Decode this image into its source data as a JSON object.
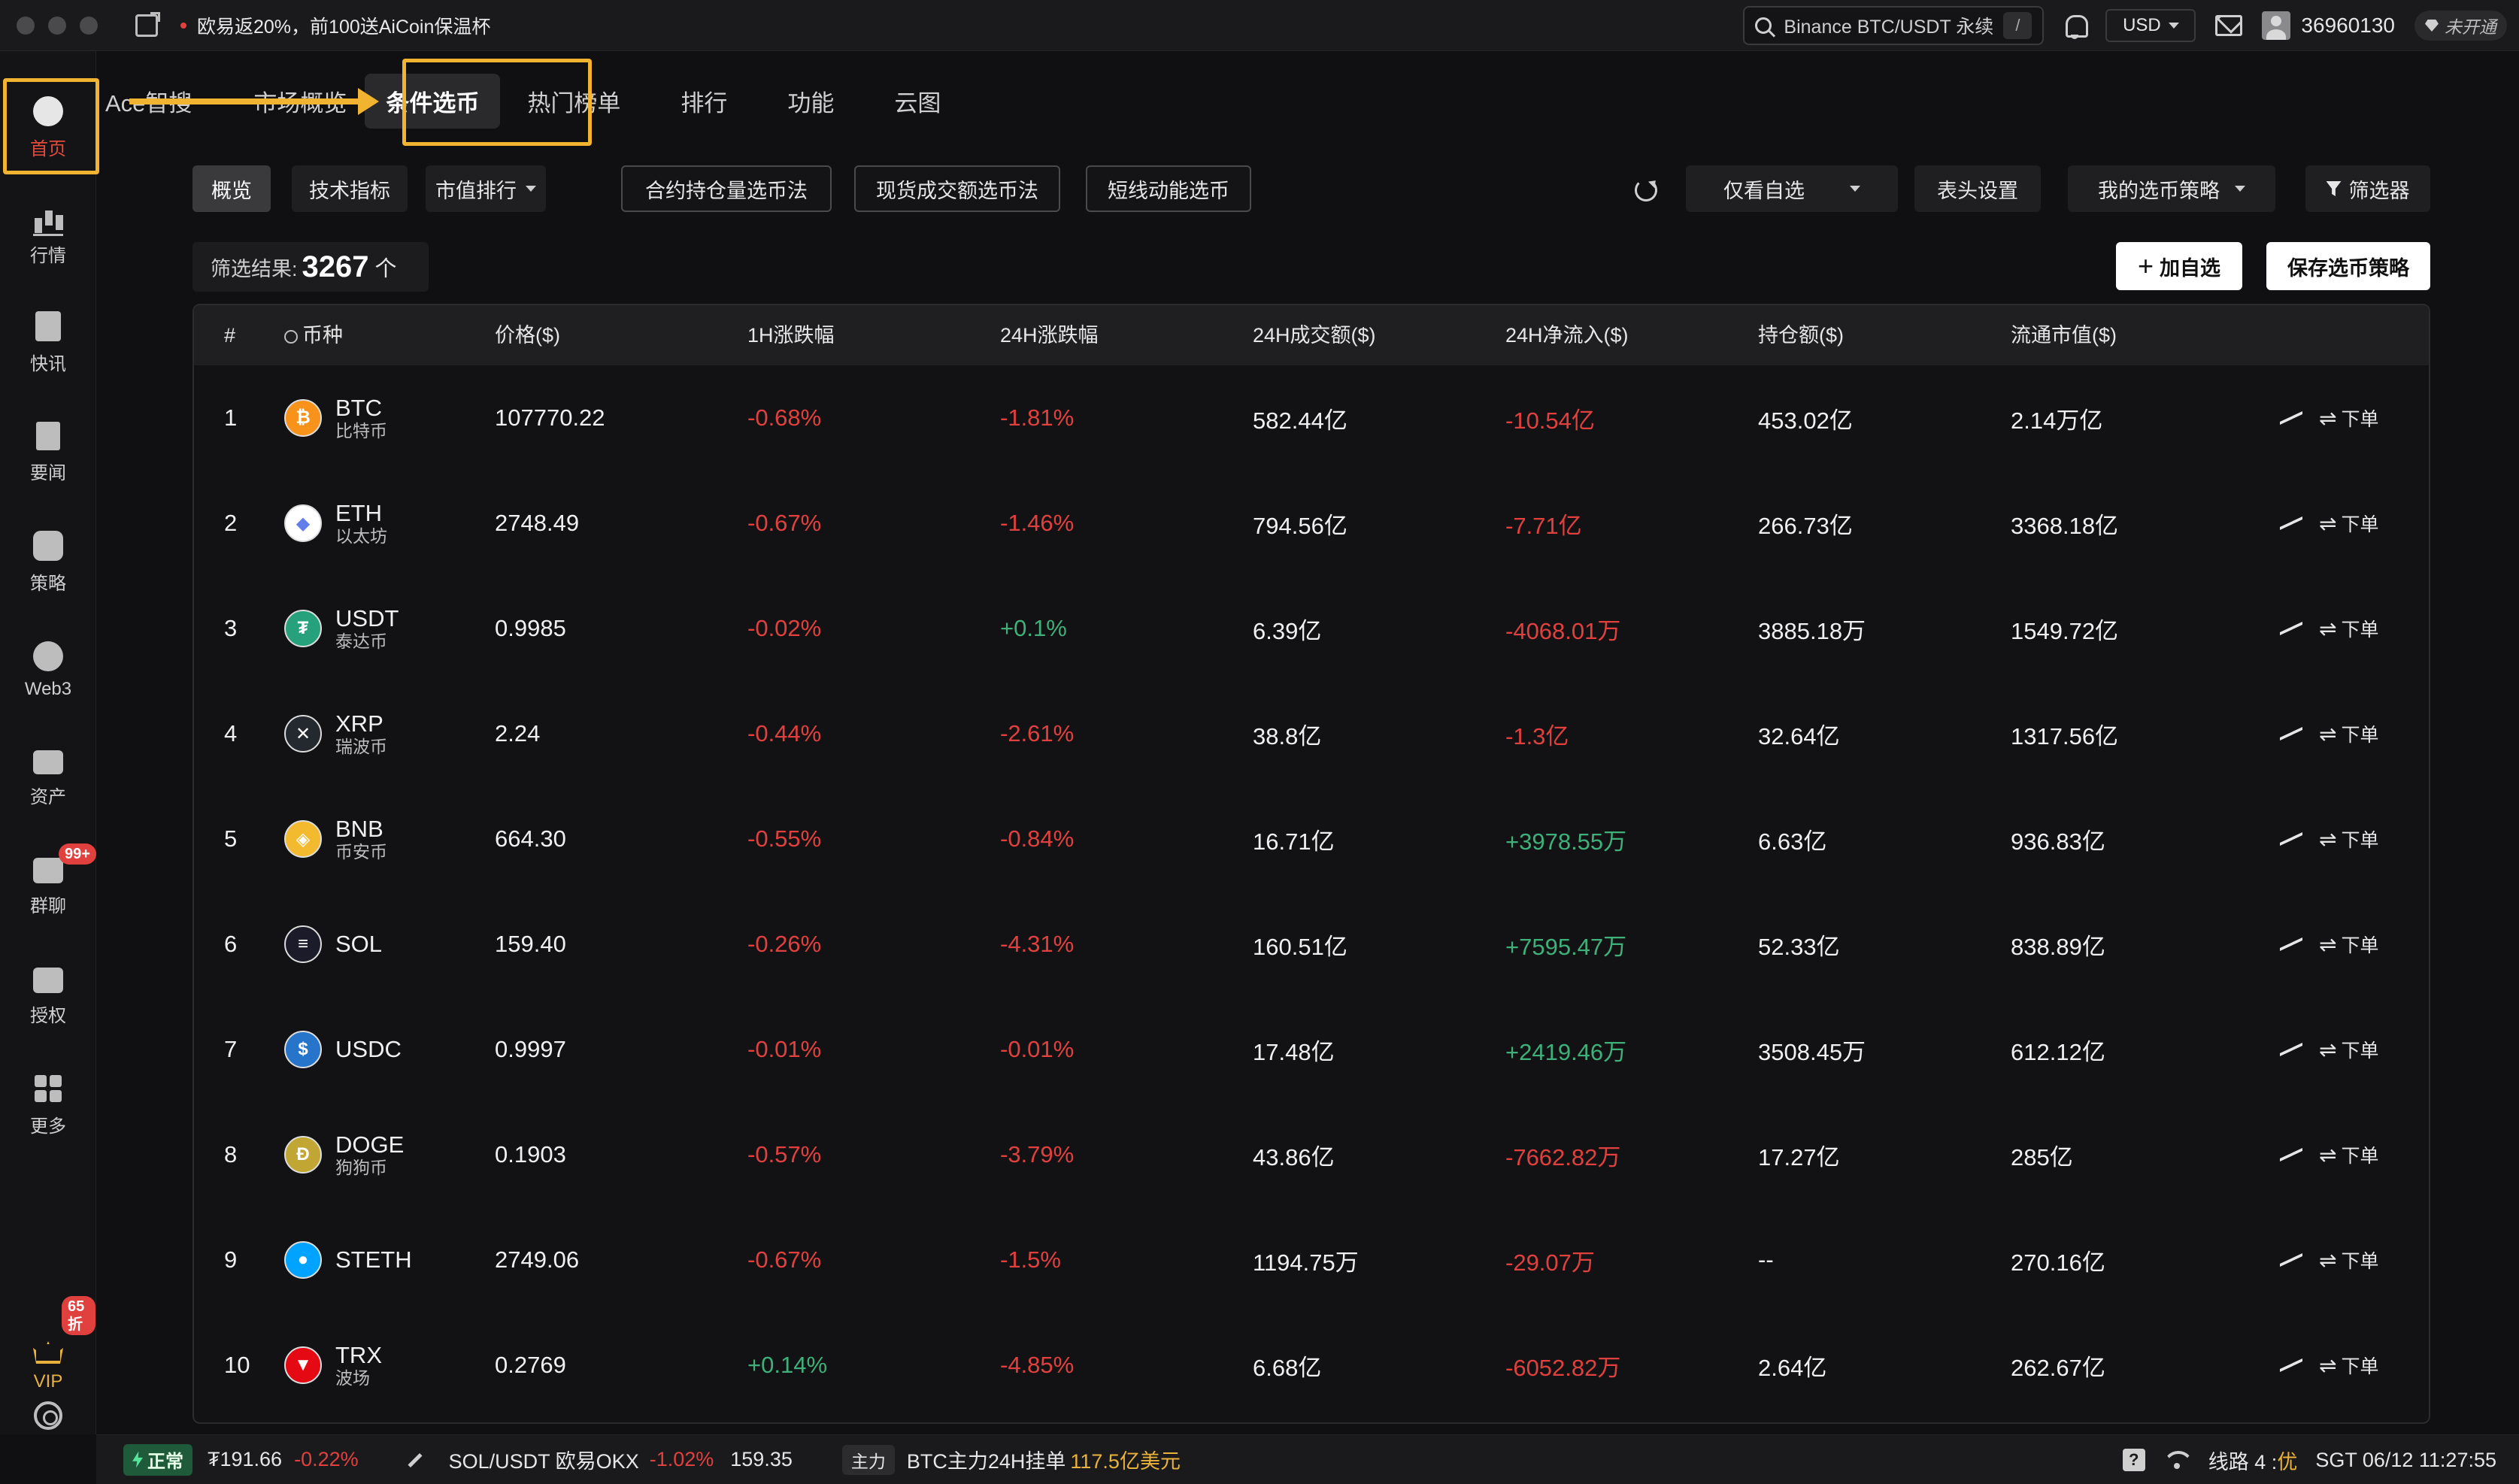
{
  "titlebar": {
    "promo": "欧易返20%，前100送AiCoin保温杯",
    "search_placeholder": "Binance BTC/USDT 永续",
    "search_shortcut": "/",
    "currency": "USD",
    "user_id": "36960130",
    "vip_status": "未开通"
  },
  "sidebar": {
    "items": [
      {
        "label": "首页"
      },
      {
        "label": "行情"
      },
      {
        "label": "快讯"
      },
      {
        "label": "要闻"
      },
      {
        "label": "策略"
      },
      {
        "label": "Web3"
      },
      {
        "label": "资产"
      },
      {
        "label": "群聊",
        "badge": "99+"
      },
      {
        "label": "授权"
      },
      {
        "label": "更多"
      },
      {
        "label": "VIP",
        "badge": "65折"
      }
    ]
  },
  "tabs": [
    "Ace智搜",
    "市场概览",
    "条件选币",
    "热门榜单",
    "排行",
    "功能",
    "云图"
  ],
  "toolbar": {
    "overview": "概览",
    "tech": "技术指标",
    "mcap_rank": "市值排行",
    "method1": "合约持仓量选币法",
    "method2": "现货成交额选币法",
    "method3": "短线动能选币",
    "watch_only": "仅看自选",
    "header_settings": "表头设置",
    "my_strategy": "我的选币策略",
    "filter": "筛选器"
  },
  "result": {
    "label": "筛选结果:",
    "count": "3267",
    "unit": "个",
    "add_watch": "加自选",
    "save_strategy": "保存选币策略"
  },
  "table": {
    "headers": [
      "#",
      "币种",
      "价格($)",
      "1H涨跌幅",
      "24H涨跌幅",
      "24H成交额($)",
      "24H净流入($)",
      "持仓额($)",
      "流通市值($)"
    ],
    "order_label": "下单",
    "rows": [
      {
        "rank": "1",
        "symbol": "BTC",
        "cn": "比特币",
        "price": "107770.22",
        "h1": "-0.68%",
        "h24": "-1.81%",
        "vol": "582.44亿",
        "flow": "-10.54亿",
        "oi": "453.02亿",
        "mcap": "2.14万亿",
        "logo_color": "#f7931a",
        "logo_text": "₿"
      },
      {
        "rank": "2",
        "symbol": "ETH",
        "cn": "以太坊",
        "price": "2748.49",
        "h1": "-0.67%",
        "h24": "-1.46%",
        "vol": "794.56亿",
        "flow": "-7.71亿",
        "oi": "266.73亿",
        "mcap": "3368.18亿",
        "logo_color": "#ffffff",
        "logo_text": "◆"
      },
      {
        "rank": "3",
        "symbol": "USDT",
        "cn": "泰达币",
        "price": "0.9985",
        "h1": "-0.02%",
        "h24": "+0.1%",
        "vol": "6.39亿",
        "flow": "-4068.01万",
        "oi": "3885.18万",
        "mcap": "1549.72亿",
        "logo_color": "#26a17b",
        "logo_text": "₮"
      },
      {
        "rank": "4",
        "symbol": "XRP",
        "cn": "瑞波币",
        "price": "2.24",
        "h1": "-0.44%",
        "h24": "-2.61%",
        "vol": "38.8亿",
        "flow": "-1.3亿",
        "oi": "32.64亿",
        "mcap": "1317.56亿",
        "logo_color": "#23292f",
        "logo_text": "✕"
      },
      {
        "rank": "5",
        "symbol": "BNB",
        "cn": "币安币",
        "price": "664.30",
        "h1": "-0.55%",
        "h24": "-0.84%",
        "vol": "16.71亿",
        "flow": "+3978.55万",
        "oi": "6.63亿",
        "mcap": "936.83亿",
        "logo_color": "#f3ba2f",
        "logo_text": "◈"
      },
      {
        "rank": "6",
        "symbol": "SOL",
        "cn": "",
        "price": "159.40",
        "h1": "-0.26%",
        "h24": "-4.31%",
        "vol": "160.51亿",
        "flow": "+7595.47万",
        "oi": "52.33亿",
        "mcap": "838.89亿",
        "logo_color": "#1b1b2a",
        "logo_text": "≡"
      },
      {
        "rank": "7",
        "symbol": "USDC",
        "cn": "",
        "price": "0.9997",
        "h1": "-0.01%",
        "h24": "-0.01%",
        "vol": "17.48亿",
        "flow": "+2419.46万",
        "oi": "3508.45万",
        "mcap": "612.12亿",
        "logo_color": "#2775ca",
        "logo_text": "$"
      },
      {
        "rank": "8",
        "symbol": "DOGE",
        "cn": "狗狗币",
        "price": "0.1903",
        "h1": "-0.57%",
        "h24": "-3.79%",
        "vol": "43.86亿",
        "flow": "-7662.82万",
        "oi": "17.27亿",
        "mcap": "285亿",
        "logo_color": "#c2a633",
        "logo_text": "Ð"
      },
      {
        "rank": "9",
        "symbol": "STETH",
        "cn": "",
        "price": "2749.06",
        "h1": "-0.67%",
        "h24": "-1.5%",
        "vol": "1194.75万",
        "flow": "-29.07万",
        "oi": "--",
        "mcap": "270.16亿",
        "logo_color": "#00a3ff",
        "logo_text": "●"
      },
      {
        "rank": "10",
        "symbol": "TRX",
        "cn": "波场",
        "price": "0.2769",
        "h1": "+0.14%",
        "h24": "-4.85%",
        "vol": "6.68亿",
        "flow": "-6052.82万",
        "oi": "2.64亿",
        "mcap": "262.67亿",
        "logo_color": "#e50914",
        "logo_text": "▼"
      }
    ]
  },
  "statusbar": {
    "status": "正常",
    "price": "₮191.66",
    "change": "-0.22%",
    "pair": "SOL/USDT 欧易OKX",
    "pair_change": "-1.02%",
    "pair_price": "159.35",
    "tag": "主力",
    "info_prefix": "BTC主力24H挂单",
    "info_value": "117.5亿美元",
    "line_label": "线路 4 :",
    "line_quality": "优",
    "time": "SGT 06/12 11:27:55",
    "help": "?"
  },
  "colors": {
    "negative": "#e0413f",
    "positive": "#3fb07a",
    "highlight": "#f2b330",
    "vip": "#e9b23a"
  }
}
